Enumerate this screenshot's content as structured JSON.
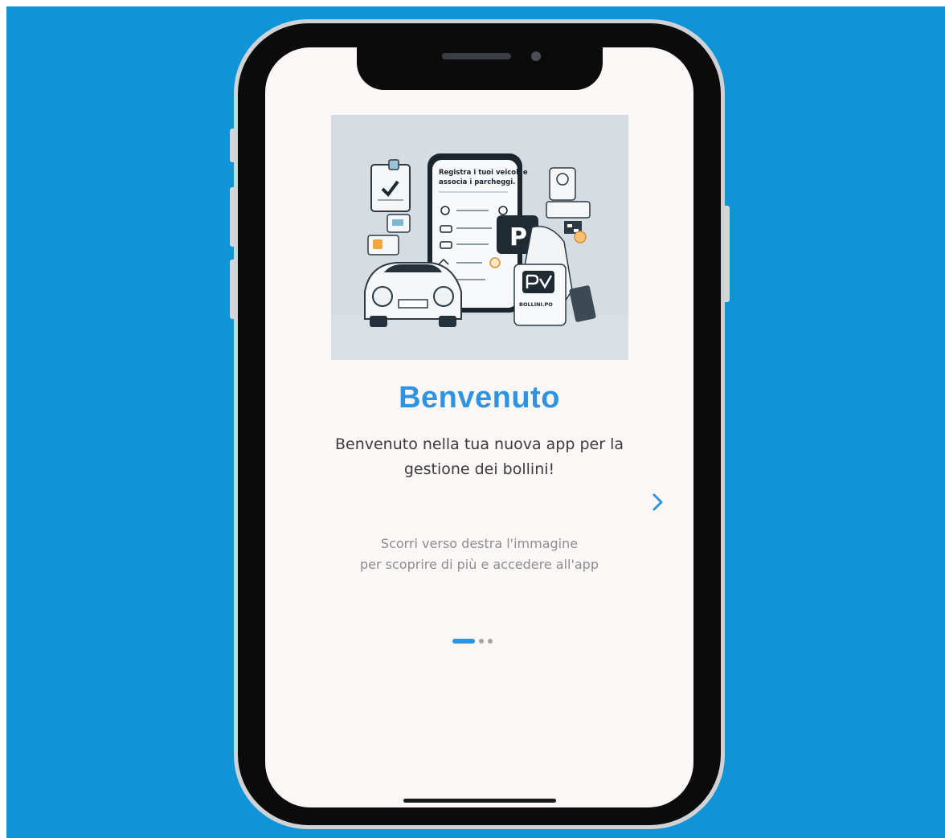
{
  "onboarding": {
    "title": "Benvenuto",
    "subtitle_line1": "Benvenuto nella tua nuova app per la",
    "subtitle_line2": "gestione dei bollini!",
    "hint_line1": "Scorri verso destra l'immagine",
    "hint_line2": "per scoprire di più e accedere all'app",
    "next_icon": "chevron-right-icon",
    "page_count": 3,
    "current_page": 1
  },
  "illustration": {
    "phone_heading_line1": "Registra i tuoi veicoli e",
    "phone_heading_line2": "associa i parcheggi.",
    "parking_sign": "P",
    "badge_label": "BOLLINI.PO"
  },
  "colors": {
    "background": "#1193d8",
    "accent": "#2e93e0",
    "screen": "#fbf7f6"
  }
}
